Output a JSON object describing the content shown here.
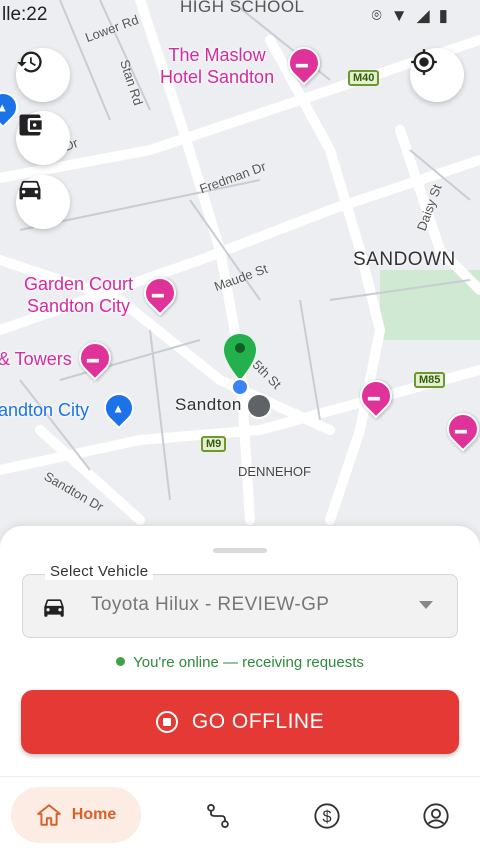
{
  "status_bar": {
    "time": "lle:22",
    "top_label": "HIGH SCHOOL"
  },
  "map": {
    "pois": [
      {
        "name": "The Maslow\nHotel Sandton",
        "kind": "hotel"
      },
      {
        "name": "Garden Court\nSandton City",
        "kind": "hotel"
      },
      {
        "name": "& Towers",
        "kind": "hotel"
      },
      {
        "name": "andton City",
        "kind": "shopping"
      }
    ],
    "areas": [
      "SANDOWN",
      "Sandton",
      "DENNEHOF"
    ],
    "streets": [
      "Lower Rd",
      "Stan Rd",
      "Fredman Dr",
      "Maude St",
      "Daisy St",
      "5th St",
      "Sandton Dr",
      "Dr"
    ],
    "highways": [
      "M40",
      "M85",
      "M9"
    ]
  },
  "sheet": {
    "select_vehicle_label": "Select Vehicle",
    "vehicle_value": "Toyota Hilux - REVIEW-GP",
    "status_text": "You're online — receiving requests",
    "go_offline_label": "GO OFFLINE"
  },
  "nav": {
    "home_label": "Home"
  },
  "colors": {
    "accent": "#e53935",
    "online": "#2e8b3a",
    "home_tab": "#d8612a",
    "pin": "#22b14c"
  }
}
